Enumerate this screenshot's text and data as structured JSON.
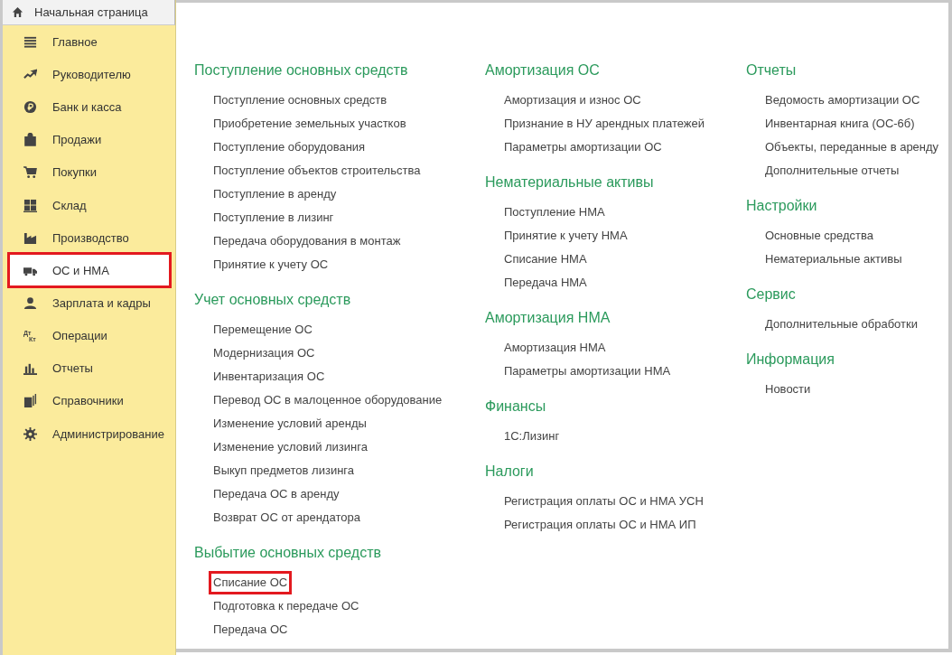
{
  "home": {
    "label": "Начальная страница"
  },
  "sidebar": {
    "items": [
      {
        "label": "Главное",
        "selected": false
      },
      {
        "label": "Руководителю",
        "selected": false
      },
      {
        "label": "Банк и касса",
        "selected": false
      },
      {
        "label": "Продажи",
        "selected": false
      },
      {
        "label": "Покупки",
        "selected": false
      },
      {
        "label": "Склад",
        "selected": false
      },
      {
        "label": "Производство",
        "selected": false
      },
      {
        "label": "ОС и НМА",
        "selected": true
      },
      {
        "label": "Зарплата и кадры",
        "selected": false
      },
      {
        "label": "Операции",
        "selected": false,
        "icon_text": [
          "Дт",
          "Кт"
        ]
      },
      {
        "label": "Отчеты",
        "selected": false
      },
      {
        "label": "Справочники",
        "selected": false
      },
      {
        "label": "Администрирование",
        "selected": false
      }
    ]
  },
  "columns": [
    {
      "sections": [
        {
          "title": "Поступление основных средств",
          "links": [
            {
              "label": "Поступление основных средств",
              "highlighted": false
            },
            {
              "label": "Приобретение земельных участков",
              "highlighted": false
            },
            {
              "label": "Поступление оборудования",
              "highlighted": false
            },
            {
              "label": "Поступление объектов строительства",
              "highlighted": false
            },
            {
              "label": "Поступление в аренду",
              "highlighted": false
            },
            {
              "label": "Поступление в лизинг",
              "highlighted": false
            },
            {
              "label": "Передача оборудования в монтаж",
              "highlighted": false
            },
            {
              "label": "Принятие к учету ОС",
              "highlighted": false
            }
          ]
        },
        {
          "title": "Учет основных средств",
          "links": [
            {
              "label": "Перемещение ОС",
              "highlighted": false
            },
            {
              "label": "Модернизация ОС",
              "highlighted": false
            },
            {
              "label": "Инвентаризация ОС",
              "highlighted": false
            },
            {
              "label": "Перевод ОС в малоценное оборудование",
              "highlighted": false
            },
            {
              "label": "Изменение условий аренды",
              "highlighted": false
            },
            {
              "label": "Изменение условий лизинга",
              "highlighted": false
            },
            {
              "label": "Выкуп предметов лизинга",
              "highlighted": false
            },
            {
              "label": "Передача ОС в аренду",
              "highlighted": false
            },
            {
              "label": "Возврат ОС от арендатора",
              "highlighted": false
            }
          ]
        },
        {
          "title": "Выбытие основных средств",
          "links": [
            {
              "label": "Списание ОС",
              "highlighted": true
            },
            {
              "label": "Подготовка к передаче ОС",
              "highlighted": false
            },
            {
              "label": "Передача ОС",
              "highlighted": false
            }
          ]
        }
      ]
    },
    {
      "sections": [
        {
          "title": "Амортизация ОС",
          "links": [
            {
              "label": "Амортизация и износ ОС",
              "highlighted": false
            },
            {
              "label": "Признание в НУ арендных платежей",
              "highlighted": false
            },
            {
              "label": "Параметры амортизации ОС",
              "highlighted": false
            }
          ]
        },
        {
          "title": "Нематериальные активы",
          "links": [
            {
              "label": "Поступление НМА",
              "highlighted": false
            },
            {
              "label": "Принятие к учету НМА",
              "highlighted": false
            },
            {
              "label": "Списание НМА",
              "highlighted": false
            },
            {
              "label": "Передача НМА",
              "highlighted": false
            }
          ]
        },
        {
          "title": "Амортизация НМА",
          "links": [
            {
              "label": "Амортизация НМА",
              "highlighted": false
            },
            {
              "label": "Параметры амортизации НМА",
              "highlighted": false
            }
          ]
        },
        {
          "title": "Финансы",
          "links": [
            {
              "label": "1С:Лизинг",
              "highlighted": false
            }
          ]
        },
        {
          "title": "Налоги",
          "links": [
            {
              "label": "Регистрация оплаты ОС и НМА УСН",
              "highlighted": false
            },
            {
              "label": "Регистрация оплаты ОС и НМА ИП",
              "highlighted": false
            }
          ]
        }
      ]
    },
    {
      "sections": [
        {
          "title": "Отчеты",
          "links": [
            {
              "label": "Ведомость амортизации ОС",
              "highlighted": false
            },
            {
              "label": "Инвентарная книга (ОС-6б)",
              "highlighted": false
            },
            {
              "label": "Объекты, переданные в аренду",
              "highlighted": false
            },
            {
              "label": "Дополнительные отчеты",
              "highlighted": false
            }
          ]
        },
        {
          "title": "Настройки",
          "links": [
            {
              "label": "Основные средства",
              "highlighted": false
            },
            {
              "label": "Нематериальные активы",
              "highlighted": false
            }
          ]
        },
        {
          "title": "Сервис",
          "links": [
            {
              "label": "Дополнительные обработки",
              "highlighted": false
            }
          ]
        },
        {
          "title": "Информация",
          "links": [
            {
              "label": "Новости",
              "highlighted": false
            }
          ]
        }
      ]
    }
  ]
}
